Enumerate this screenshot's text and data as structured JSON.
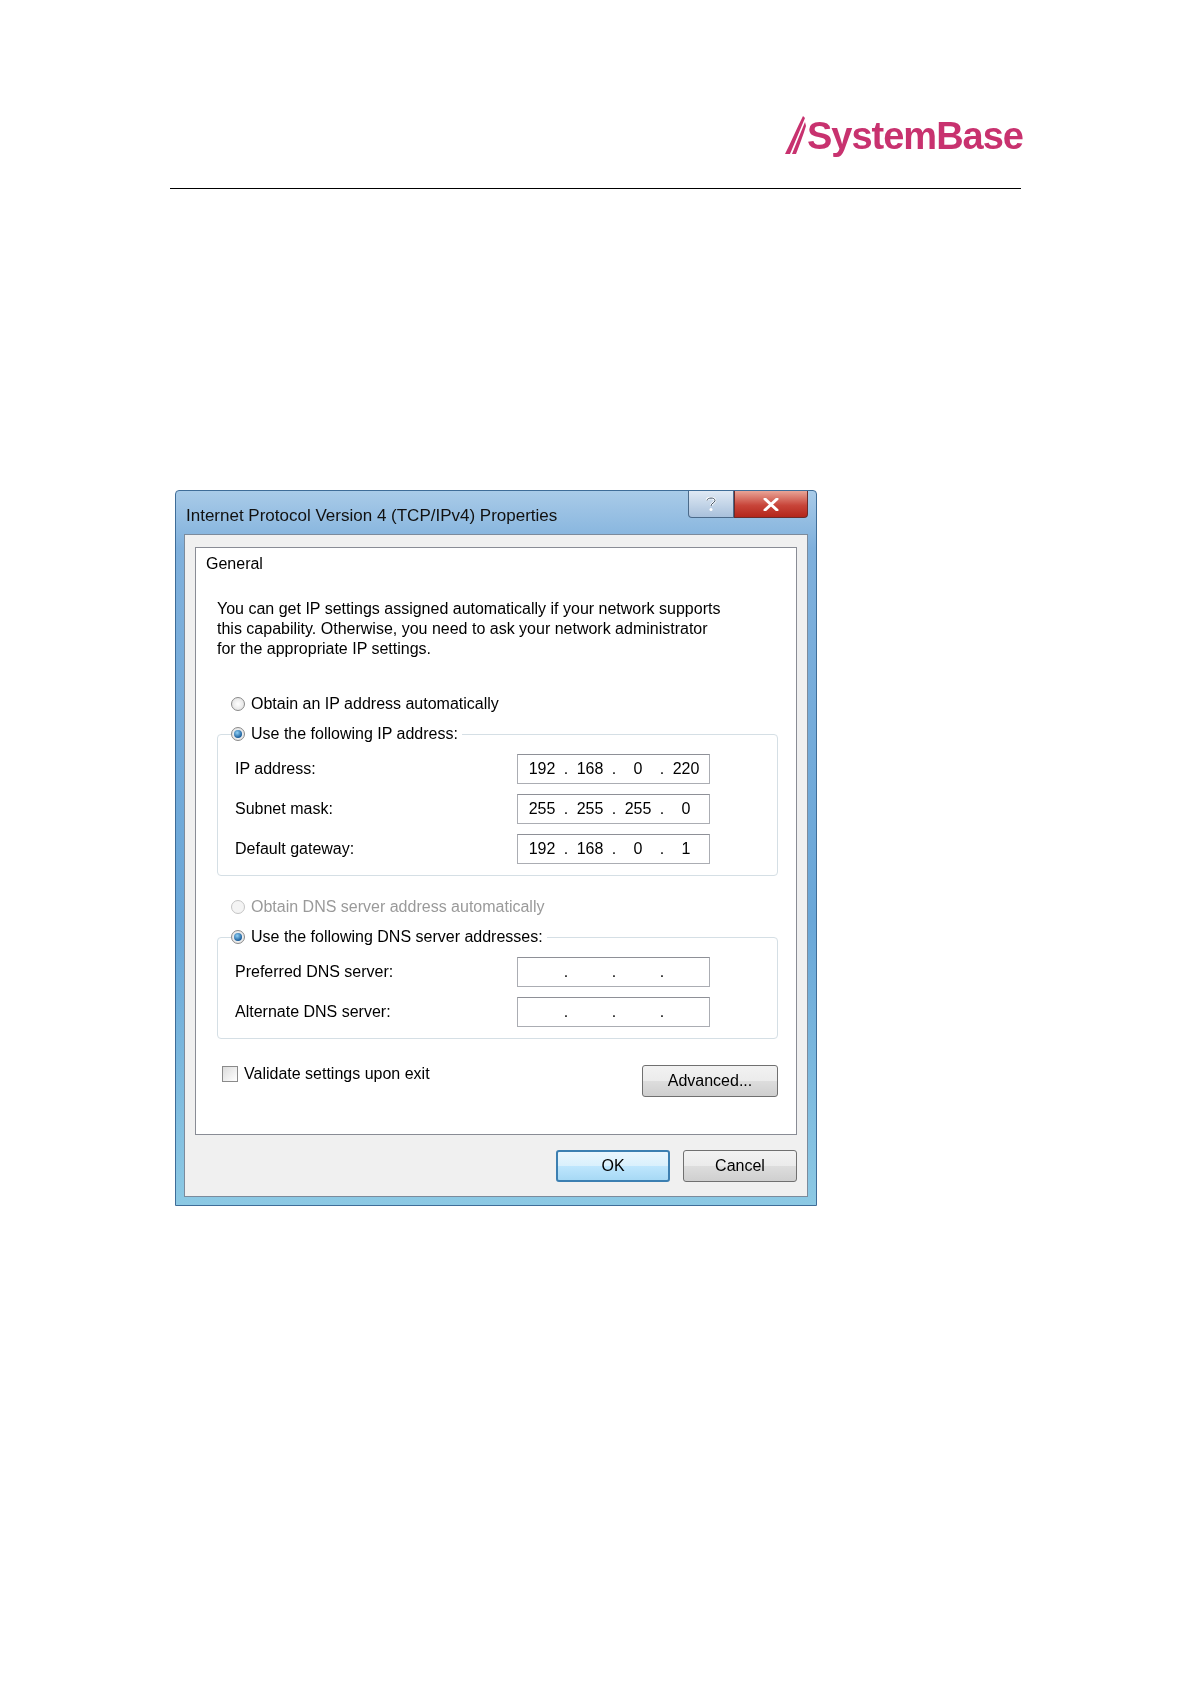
{
  "logo": {
    "text": "SystemBase"
  },
  "dialog": {
    "title": "Internet Protocol Version 4 (TCP/IPv4) Properties",
    "tabs": [
      {
        "label": "General",
        "selected": true
      }
    ],
    "description": "You can get IP settings assigned automatically if your network supports\nthis capability. Otherwise, you need to ask your network administrator\nfor the appropriate IP settings.",
    "ip_mode": [
      {
        "label": "Obtain an IP address automatically",
        "selected": false,
        "disabled": false
      },
      {
        "label": "Use the following IP address:",
        "selected": true,
        "disabled": false,
        "fields": [
          {
            "label": "IP address:",
            "segments": [
              "192",
              ".",
              "168",
              ".",
              "0",
              ".",
              "220"
            ]
          },
          {
            "label": "Subnet mask:",
            "segments": [
              "255",
              ".",
              "255",
              ".",
              "255",
              ".",
              "0"
            ]
          },
          {
            "label": "Default gateway:",
            "segments": [
              "192",
              ".",
              "168",
              ".",
              "0",
              ".",
              "1"
            ]
          }
        ]
      }
    ],
    "dns_mode": [
      {
        "label": "Obtain DNS server address automatically",
        "selected": false,
        "disabled": true
      },
      {
        "label": "Use the following DNS server addresses:",
        "selected": true,
        "disabled": false,
        "fields": [
          {
            "label": "Preferred DNS server:",
            "segments": [
              ".",
              ".",
              "."
            ]
          },
          {
            "label": "Alternate DNS server:",
            "segments": [
              ".",
              ".",
              "."
            ]
          }
        ]
      }
    ],
    "validate": {
      "label": "Validate settings upon exit",
      "checked": false
    },
    "advanced_button": "Advanced...",
    "buttons": [
      {
        "label": "OK",
        "default": true
      },
      {
        "label": "Cancel",
        "default": false
      }
    ]
  }
}
